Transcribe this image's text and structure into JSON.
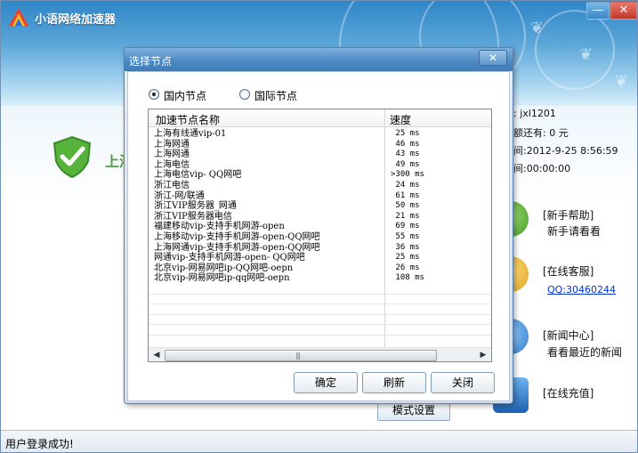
{
  "app": {
    "title": "小语网络加速器",
    "minimize": "—",
    "close": "✕",
    "status_text": "上海",
    "status_message": "用户登录成功!",
    "mode_button": "模式设置"
  },
  "account": {
    "username_line": ": jxl1201",
    "balance_line": "额还有: 0 元",
    "time_line": "间:2012-9-25  8:56:59",
    "duration_line": "间:00:00:00"
  },
  "side_panel": [
    {
      "title": "[新手帮助]",
      "sub": "新手请看看",
      "icon": "help-icon"
    },
    {
      "title": "[在线客服]",
      "sub": "QQ:30460244",
      "icon": "support-icon"
    },
    {
      "title": "[新闻中心]",
      "sub": "看看最近的新闻",
      "icon": "news-icon"
    },
    {
      "title": "[在线充值]",
      "sub": "",
      "icon": "recharge-icon"
    }
  ],
  "dialog": {
    "title": "选择节点",
    "close": "✕",
    "radio_domestic": "国内节点",
    "radio_international": "国际节点",
    "selected_radio": "domestic",
    "columns": [
      "加速节点名称",
      "速度"
    ],
    "rows": [
      {
        "name": "上海有线通vip-01",
        "speed": " 25 ms"
      },
      {
        "name": "上海网通",
        "speed": " 46 ms"
      },
      {
        "name": "上海网通",
        "speed": " 43 ms"
      },
      {
        "name": "上海电信",
        "speed": " 49 ms"
      },
      {
        "name": "上海电信vip- QQ网吧",
        "speed": ">300 ms"
      },
      {
        "name": "浙江电信",
        "speed": " 24 ms"
      },
      {
        "name": "浙江-网/联通",
        "speed": " 61 ms"
      },
      {
        "name": "浙江VIP服务器_网通",
        "speed": " 50 ms"
      },
      {
        "name": "浙江VIP服务器电信",
        "speed": " 21 ms"
      },
      {
        "name": "福建移动vip-支持手机网游-open",
        "speed": " 69 ms"
      },
      {
        "name": "上海移动vip-支持手机网游-open-QQ网吧",
        "speed": " 55 ms"
      },
      {
        "name": "上海网通vip-支持手机网游-open-QQ网吧",
        "speed": " 36 ms"
      },
      {
        "name": "网通vip-支持手机网游-open- QQ网吧",
        "speed": " 25 ms"
      },
      {
        "name": "北京vip-网易网吧ip-QQ网吧-oepn",
        "speed": " 26 ms"
      },
      {
        "name": "北京vip-网易网吧ip-qq网吧-oepn",
        "speed": " 108 ms"
      }
    ],
    "scroll_left": "◀",
    "scroll_right": "▶",
    "scroll_grip": "|||",
    "ok": "确定",
    "refresh": "刷新",
    "close_button": "关闭"
  },
  "colors": {
    "header_blue": "#2f86c7",
    "status_green": "#4aa33a",
    "link_blue": "#0033cc"
  }
}
